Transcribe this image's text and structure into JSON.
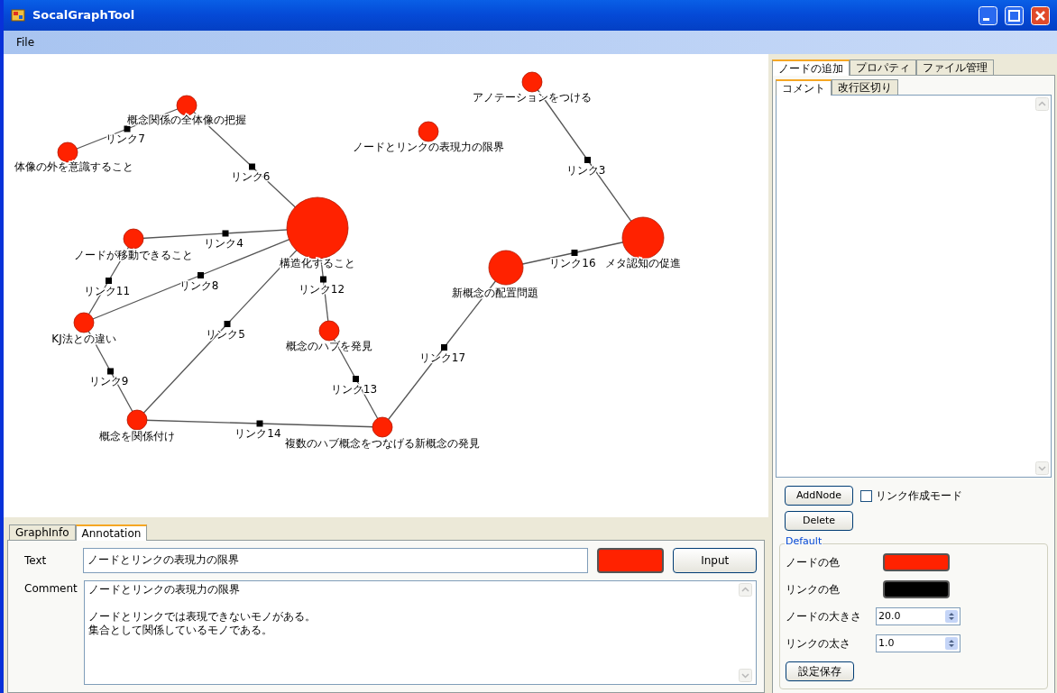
{
  "window": {
    "title": "SocalGraphTool"
  },
  "menu": [
    "File"
  ],
  "graph": {
    "nodes": [
      {
        "label": "概念関係の全体像の把握"
      },
      {
        "label": "体像の外を意識すること"
      },
      {
        "label": "アノテーションをつける"
      },
      {
        "label": "ノードとリンクの表現力の限界"
      },
      {
        "label": "構造化すること"
      },
      {
        "label": "ノードが移動できること"
      },
      {
        "label": "メタ認知の促進"
      },
      {
        "label": "新概念の配置問題"
      },
      {
        "label": "KJ法との違い"
      },
      {
        "label": "概念のハブを発見"
      },
      {
        "label": "概念を関係付け"
      },
      {
        "label": "複数のハブ概念をつなげる新概念の発見"
      }
    ],
    "links": [
      {
        "label": "リンク7"
      },
      {
        "label": "リンク3"
      },
      {
        "label": "リンク6"
      },
      {
        "label": "リンク4"
      },
      {
        "label": "リンク16"
      },
      {
        "label": "リンク8"
      },
      {
        "label": "リンク11"
      },
      {
        "label": "リンク12"
      },
      {
        "label": "リンク5"
      },
      {
        "label": "リンク17"
      },
      {
        "label": "リンク9"
      },
      {
        "label": "リンク13"
      },
      {
        "label": "リンク14"
      }
    ]
  },
  "bottom_panel": {
    "tabs": [
      {
        "label": "GraphInfo",
        "selected": false
      },
      {
        "label": "Annotation",
        "selected": true
      }
    ],
    "text_label": "Text",
    "text_value": "ノードとリンクの表現力の限界",
    "color": "#ff2200",
    "input_button": "Input",
    "comment_label": "Comment",
    "comment_paragraphs": [
      [
        "ノードとリンクの表現力の限界"
      ],
      [
        "ノードとリンクでは表現できないモノがある。",
        "集合として関係しているモノである。"
      ]
    ]
  },
  "right_panel": {
    "tabs": [
      {
        "label": "ノードの追加",
        "selected": true
      },
      {
        "label": "プロパティ",
        "selected": false
      },
      {
        "label": "ファイル管理",
        "selected": false
      }
    ],
    "sub_tabs": [
      {
        "label": "コメント",
        "selected": true
      },
      {
        "label": "改行区切り",
        "selected": false
      }
    ],
    "add_node_button": "AddNode",
    "link_mode": {
      "label": "リンク作成モード",
      "checked": false
    },
    "delete_button": "Delete",
    "default_group": {
      "title": "Default",
      "rows": [
        {
          "kind": "color",
          "label": "ノードの色",
          "color": "#ff2200"
        },
        {
          "kind": "color",
          "label": "リンクの色",
          "color": "#000000"
        },
        {
          "kind": "number",
          "label": "ノードの大きさ",
          "value": "20.0"
        },
        {
          "kind": "number",
          "label": "リンクの太さ",
          "value": "1.0"
        }
      ]
    },
    "save_button": "設定保存"
  }
}
